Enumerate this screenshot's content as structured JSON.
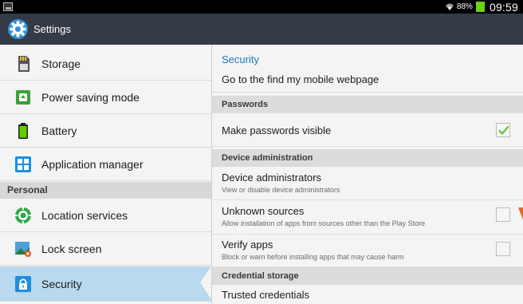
{
  "status_bar": {
    "battery_percent": "88%",
    "time": "09:59",
    "battery_color": "#6bd30f"
  },
  "action_bar": {
    "title": "Settings",
    "icon": "settings-gear-icon"
  },
  "sidebar": {
    "items": [
      {
        "label": "Storage",
        "icon": "storage-sd-card-icon"
      },
      {
        "label": "Power saving mode",
        "icon": "power-saving-icon"
      },
      {
        "label": "Battery",
        "icon": "battery-icon"
      },
      {
        "label": "Application manager",
        "icon": "application-manager-icon"
      }
    ],
    "section_personal": "Personal",
    "personal_items": [
      {
        "label": "Location services",
        "icon": "location-icon"
      },
      {
        "label": "Lock screen",
        "icon": "lock-screen-icon"
      },
      {
        "label": "Security",
        "icon": "security-lock-icon",
        "selected": true
      }
    ]
  },
  "panel": {
    "title": "Security",
    "find_mobile": "Go to the find my mobile webpage",
    "passwords_header": "Passwords",
    "make_passwords_visible": {
      "label": "Make passwords visible",
      "checked": true
    },
    "device_admin_header": "Device administration",
    "device_administrators": {
      "label": "Device administrators",
      "summary": "View or disable device administrators"
    },
    "unknown_sources": {
      "label": "Unknown sources",
      "summary": "Allow installation of apps from sources other than the Play Store",
      "checked": false
    },
    "verify_apps": {
      "label": "Verify apps",
      "summary": "Block or warn before installing apps that may cause harm",
      "checked": false
    },
    "credential_header": "Credential storage",
    "trusted_credentials": "Trusted credentials"
  },
  "colors": {
    "accent": "#1b7bbf",
    "action_bar": "#343b47",
    "selected_row": "#b9d9ee",
    "check_green": "#5fc43a"
  }
}
